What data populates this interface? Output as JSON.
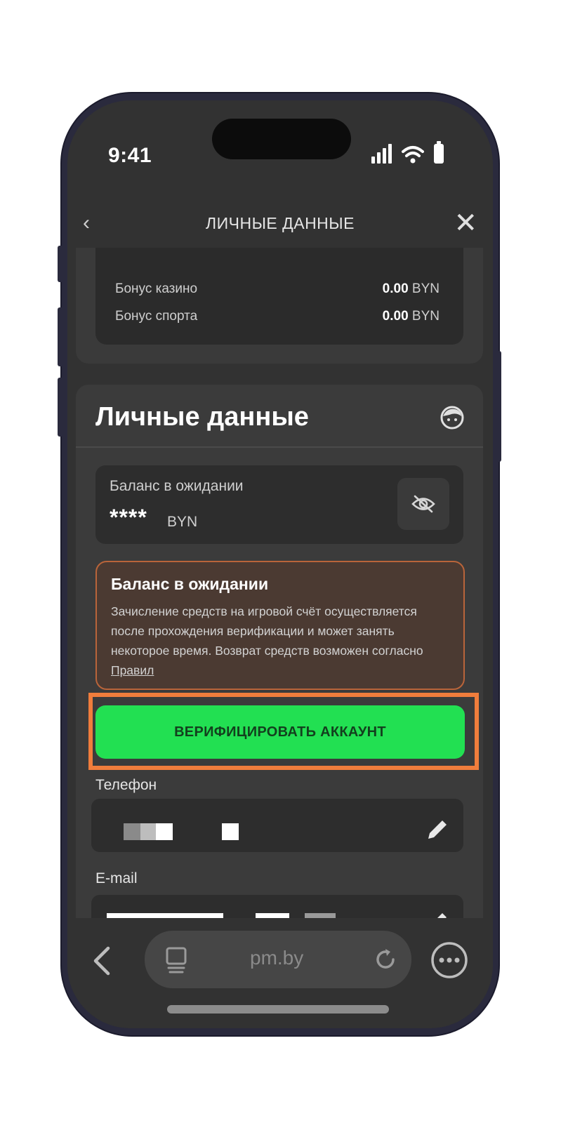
{
  "status_bar": {
    "time": "9:41"
  },
  "nav": {
    "back_symbol": "‹",
    "title": "ЛИЧНЫЕ ДАННЫЕ",
    "close_symbol": "✕"
  },
  "bonuses": [
    {
      "label": "Бонус казино",
      "amount": "0.00",
      "currency": "BYN"
    },
    {
      "label": "Бонус спорта",
      "amount": "0.00",
      "currency": "BYN"
    }
  ],
  "personal": {
    "title": "Личные данные",
    "pending_balance": {
      "label": "Баланс в ожидании",
      "masked_value": "****",
      "currency": "BYN"
    },
    "notice": {
      "title": "Баланс в ожидании",
      "text": "Зачисление средств на игровой счёт осуществляется после прохождения верификации и может занять некоторое время. Возврат средств возможен согласно",
      "link": "Правил"
    },
    "verify_button": "ВЕРИФИЦИРОВАТЬ АККАУНТ",
    "phone_label": "Телефон",
    "email_label": "E-mail"
  },
  "browser": {
    "url": "pm.by"
  },
  "colors": {
    "accent_green": "#22e052",
    "highlight_orange": "#f07d3c",
    "notice_border": "#b9643a",
    "screen_bg": "#323232"
  }
}
